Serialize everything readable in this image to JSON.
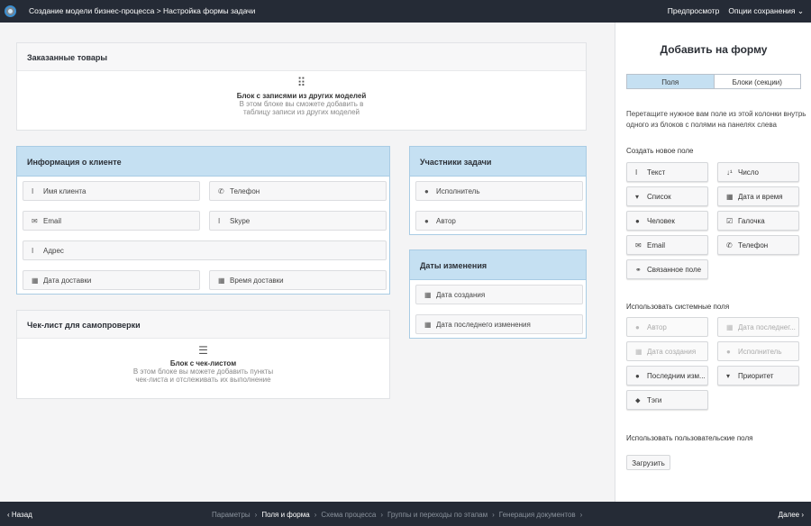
{
  "topbar": {
    "breadcrumb": "Создание модели бизнес-процесса > Настройка формы задачи",
    "preview": "Предпросмотр",
    "save_options": "Опции сохранения"
  },
  "panels": {
    "ordered": {
      "title": "Заказанные товары",
      "block_title": "Блок с записями из других моделей",
      "block_desc1": "В этом блоке вы сможете добавить в",
      "block_desc2": "таблицу записи из других моделей"
    },
    "client": {
      "title": "Информация о клиенте",
      "fields": [
        "Имя клиента",
        "Телефон",
        "Email",
        "Skype",
        "Адрес",
        "Дата доставки",
        "Время доставки"
      ]
    },
    "checklist": {
      "title": "Чек-лист для самопроверки",
      "block_title": "Блок с чек-листом",
      "block_desc1": "В этом блоке вы можете добавить пункты",
      "block_desc2": "чек-листа и отслеживать их выполнение"
    },
    "participants": {
      "title": "Участники задачи",
      "fields": [
        "Исполнитель",
        "Автор"
      ]
    },
    "dates": {
      "title": "Даты изменения",
      "fields": [
        "Дата создания",
        "Дата последнего изменения"
      ]
    }
  },
  "side": {
    "title": "Добавить на форму",
    "tabs": [
      "Поля",
      "Блоки (секции)"
    ],
    "description": "Перетащите нужное вам поле из этой колонки внутрь одного из блоков с полями на панелях слева",
    "create_label": "Создать новое поле",
    "create_buttons": [
      "Текст",
      "Число",
      "Список",
      "Дата и время",
      "Человек",
      "Галочка",
      "Email",
      "Телефон",
      "Связанное поле"
    ],
    "system_label": "Использовать системные поля",
    "system_buttons": [
      "Автор",
      "Дата последнег...",
      "Дата создания",
      "Исполнитель",
      "Последним изм...",
      "Приоритет",
      "Тэги"
    ],
    "custom_label": "Использовать пользовательские поля",
    "load_button": "Загрузить"
  },
  "footer": {
    "back": "Назад",
    "next": "Далее",
    "steps": [
      "Параметры",
      "Поля и форма",
      "Схема процесса",
      "Группы и переходы по этапам",
      "Генерация документов"
    ],
    "current_step": 1
  },
  "colors": {
    "topbar": "#252b36",
    "selected_header": "#c5e0f2"
  }
}
